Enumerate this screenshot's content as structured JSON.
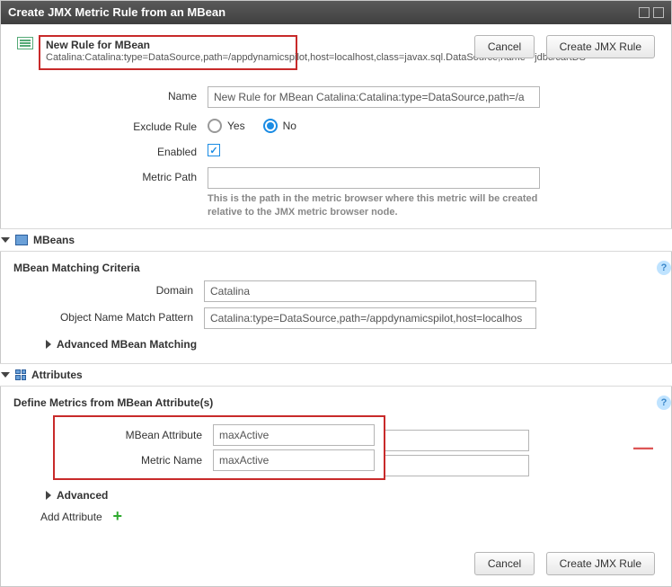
{
  "title": "Create JMX Metric Rule from an MBean",
  "header": {
    "rule_title": "New Rule for MBean",
    "rule_desc": "Catalina:Catalina:type=DataSource,path=/appdynamicspilot,host=localhost,class=javax.sql.DataSource,name=\"jdbc/cartDS\"",
    "cancel": "Cancel",
    "create": "Create JMX Rule"
  },
  "form": {
    "name_label": "Name",
    "name_value": "New Rule for MBean Catalina:Catalina:type=DataSource,path=/a",
    "exclude_label": "Exclude Rule",
    "yes": "Yes",
    "no": "No",
    "enabled_label": "Enabled",
    "metric_path_label": "Metric Path",
    "metric_path_value": "",
    "metric_path_hint": "This is the path in the metric browser where this metric will be created relative to the JMX metric browser node."
  },
  "mbeans": {
    "section": "MBeans",
    "criteria": "MBean Matching Criteria",
    "domain_label": "Domain",
    "domain_value": "Catalina",
    "pattern_label": "Object Name Match Pattern",
    "pattern_value": "Catalina:type=DataSource,path=/appdynamicspilot,host=localhos",
    "advanced": "Advanced MBean Matching"
  },
  "attributes": {
    "section": "Attributes",
    "define": "Define Metrics from MBean Attribute(s)",
    "mbean_attr_label": "MBean Attribute",
    "mbean_attr_value": "maxActive",
    "metric_name_label": "Metric Name",
    "metric_name_value": "maxActive",
    "advanced": "Advanced",
    "add": "Add Attribute"
  },
  "footer": {
    "cancel": "Cancel",
    "create": "Create JMX Rule"
  }
}
